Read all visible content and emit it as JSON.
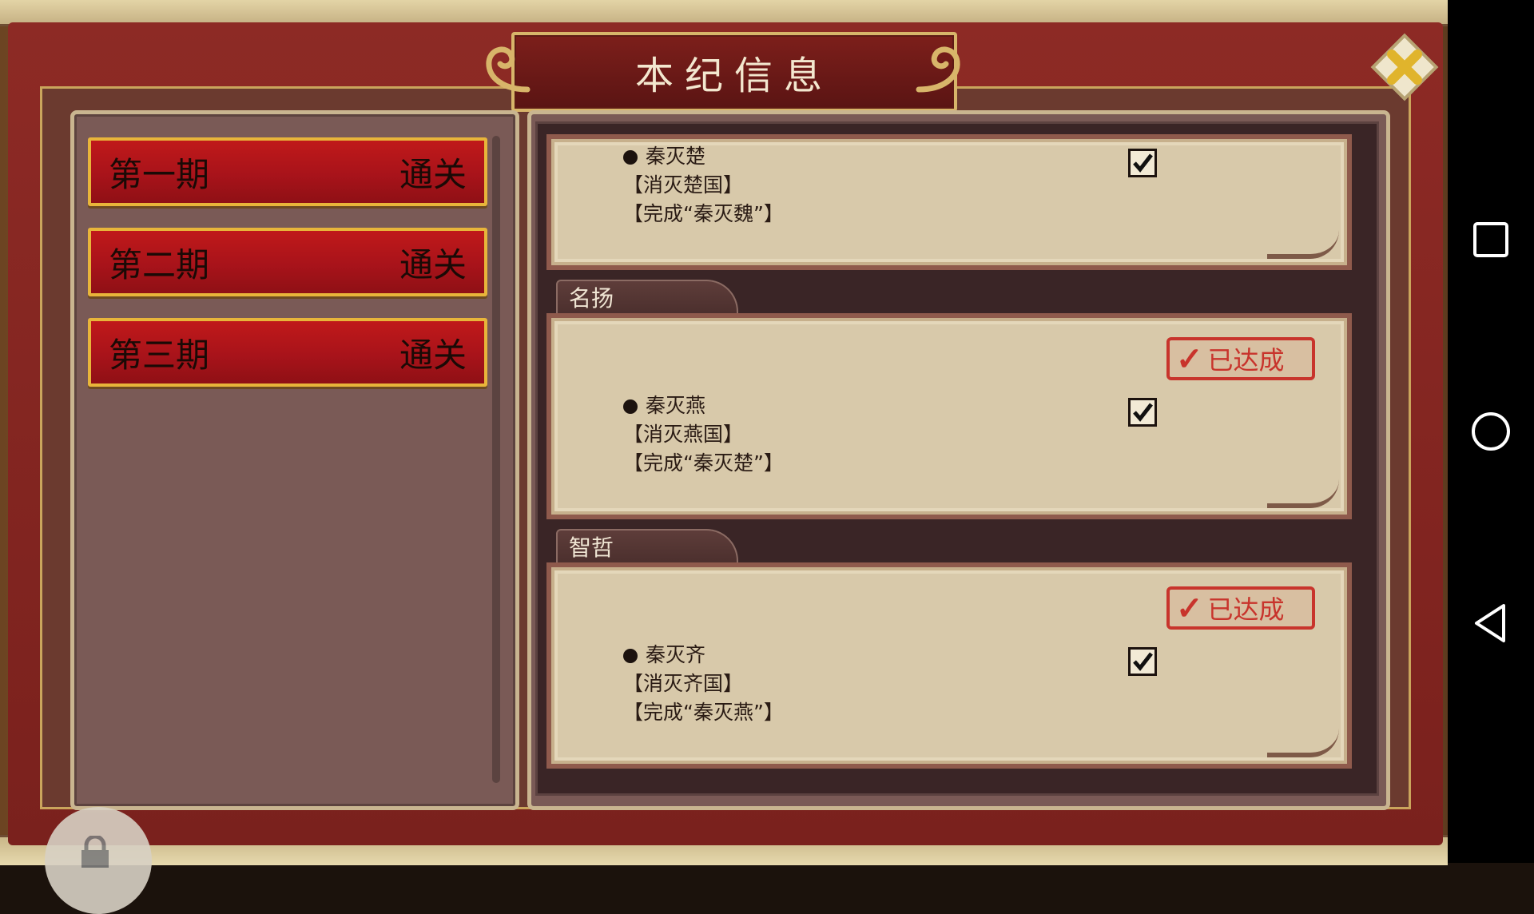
{
  "dialog": {
    "title": "本纪信息"
  },
  "stages": [
    {
      "name": "第一期",
      "status": "通关"
    },
    {
      "name": "第二期",
      "status": "通关"
    },
    {
      "name": "第三期",
      "status": "通关"
    }
  ],
  "achievements": [
    {
      "category": "",
      "name": "秦灭楚",
      "line1": "【消灭楚国】",
      "line2": "【完成“秦灭魏”】",
      "checked": true,
      "stamp": ""
    },
    {
      "category": "名扬",
      "name": "秦灭燕",
      "line1": "【消灭燕国】",
      "line2": "【完成“秦灭楚”】",
      "checked": true,
      "stamp": "已达成"
    },
    {
      "category": "智哲",
      "name": "秦灭齐",
      "line1": "【消灭齐国】",
      "line2": "【完成“秦灭燕”】",
      "checked": true,
      "stamp": "已达成"
    }
  ],
  "icons": {
    "close": "close-x-icon",
    "check": "check-icon",
    "lock": "lock-icon",
    "nav_recent": "square-icon",
    "nav_home": "circle-icon",
    "nav_back": "triangle-back-icon"
  },
  "colors": {
    "frame_red": "#8d2a25",
    "button_red": "#c0191a",
    "gold_border": "#e8b53a",
    "card_paper": "#d8c9aa",
    "stamp_red": "#c8342c"
  }
}
